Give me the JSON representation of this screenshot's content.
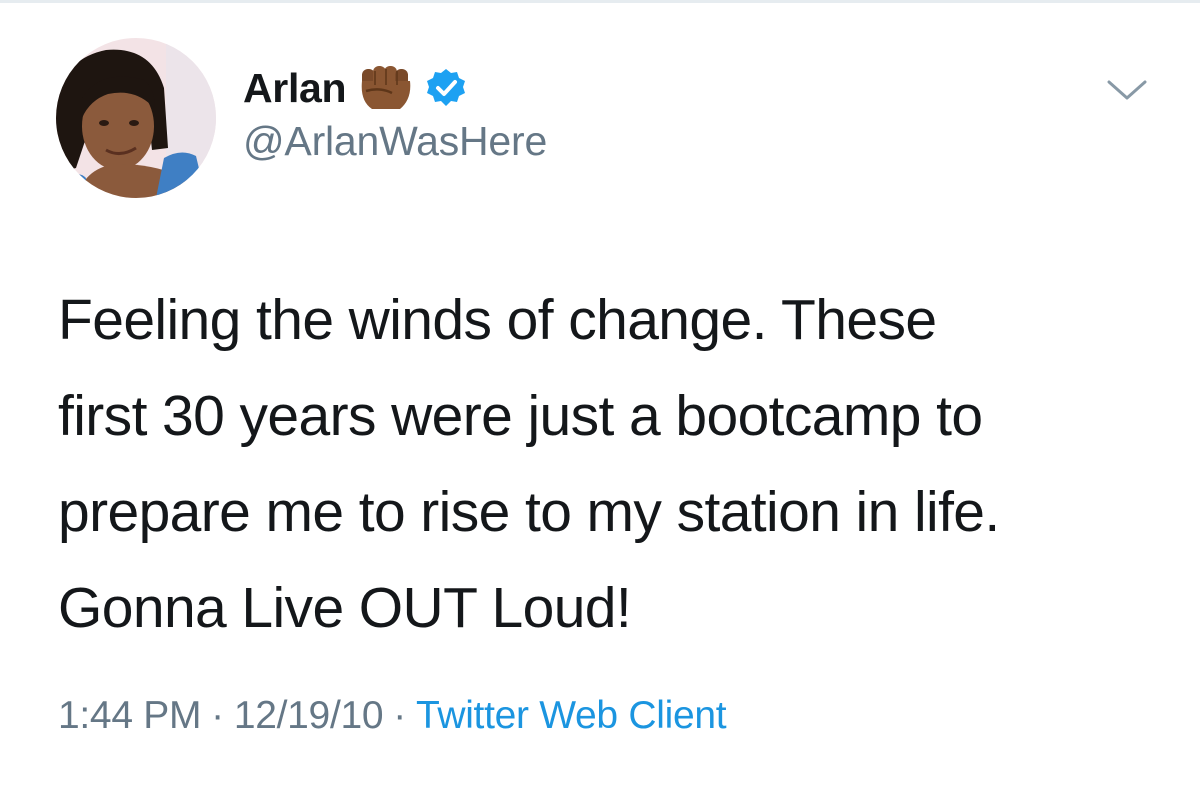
{
  "tweet": {
    "display_name": "Arlan",
    "handle": "@ArlanWasHere",
    "text": "Feeling the winds of change. These\nfirst 30 years were just a bootcamp to\nprepare me to rise to my station in life.\nGonna Live OUT Loud!",
    "time": "1:44 PM",
    "date": "12/19/10",
    "separator": "·",
    "source": "Twitter Web Client"
  },
  "icons": {
    "avatar": "profile-photo",
    "emoji": "raised-fist-medium-dark-skin-tone",
    "badge": "verified-badge",
    "menu": "chevron-down"
  },
  "colors": {
    "text": "#14171a",
    "secondary": "#657786",
    "link": "#1b95e0",
    "verified": "#1da1f2"
  }
}
